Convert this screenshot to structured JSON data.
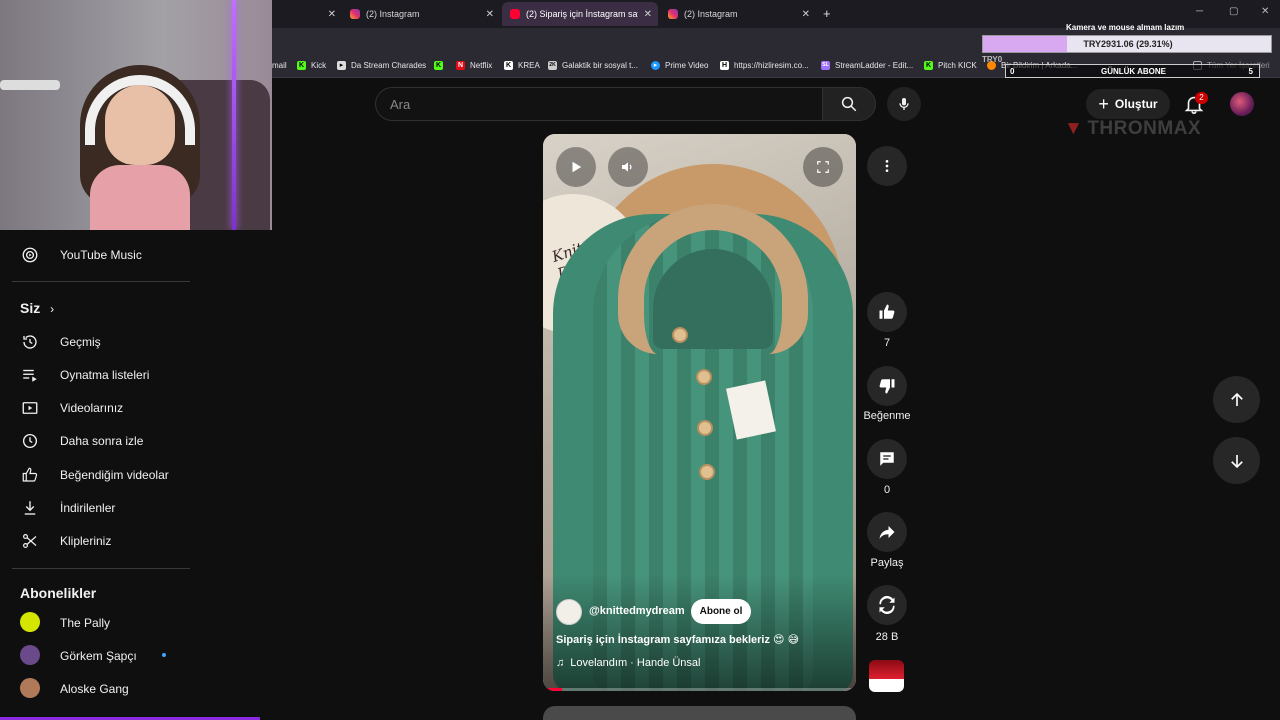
{
  "browser": {
    "tabs": [
      {
        "label": "",
        "favicon": "none"
      },
      {
        "label": "(2) Instagram",
        "favicon": "instagram-icon"
      },
      {
        "label": "(2) Sipariş için İnstagram sayfam",
        "favicon": "youtube-icon",
        "active": true
      },
      {
        "label": "(2) Instagram",
        "favicon": "instagram-icon"
      }
    ],
    "bookmarks": [
      {
        "label": "mail",
        "icon": "gmail-icon",
        "color": "#ea4335"
      },
      {
        "label": "Kick",
        "icon": "kick-icon",
        "color": "#53fc18"
      },
      {
        "label": "Da Stream Charades",
        "icon": "pointer-icon",
        "color": "#ffffff"
      },
      {
        "label": "",
        "icon": "kick-icon",
        "color": "#53fc18"
      },
      {
        "label": "Netflix",
        "icon": "netflix-icon",
        "color": "#e50914"
      },
      {
        "label": "KREA",
        "icon": "krea-icon",
        "color": "#ffffff"
      },
      {
        "label": "Galaktik bir sosyal t...",
        "icon": "zk-icon",
        "color": "#cccccc"
      },
      {
        "label": "Prime Video",
        "icon": "prime-icon",
        "color": "#1a98ff"
      },
      {
        "label": "https://hizliresim.co...",
        "icon": "h-icon",
        "color": "#ffffff"
      },
      {
        "label": "StreamLadder - Edit...",
        "icon": "sl-icon",
        "color": "#a070ff"
      },
      {
        "label": "Pitch KICK",
        "icon": "kick-icon",
        "color": "#53fc18"
      },
      {
        "label": "Bir Bildirim | Arkada...",
        "icon": "bell-icon",
        "color": "#ff8800"
      },
      {
        "label": "Tüm Yer İşaretleri",
        "icon": "folder-icon",
        "color": "#cccccc"
      }
    ]
  },
  "header": {
    "search_placeholder": "Ara",
    "create_label": "Oluştur",
    "notification_count": "2"
  },
  "sidebar": {
    "top_item": "YouTube Music",
    "you_heading": "Siz",
    "you_items": [
      {
        "label": "Geçmiş",
        "icon": "history-icon"
      },
      {
        "label": "Oynatma listeleri",
        "icon": "playlists-icon"
      },
      {
        "label": "Videolarınız",
        "icon": "your-videos-icon"
      },
      {
        "label": "Daha sonra izle",
        "icon": "watch-later-icon"
      },
      {
        "label": "Beğendiğim videolar",
        "icon": "liked-videos-icon"
      },
      {
        "label": "İndirilenler",
        "icon": "downloads-icon"
      },
      {
        "label": "Klipleriniz",
        "icon": "clips-icon"
      }
    ],
    "subs_heading": "Abonelikler",
    "subscriptions": [
      {
        "label": "The Pally",
        "color": "#d4e600",
        "live": false
      },
      {
        "label": "Görkem Şapçı",
        "color": "#6a4a8a",
        "live": true
      },
      {
        "label": "Aloske Gang",
        "color": "#b07a5a",
        "live": false
      }
    ]
  },
  "short": {
    "sign_text": "Knitted Dream",
    "channel": "@knittedmydream",
    "subscribe_label": "Abone ol",
    "title": "Sipariş için İnstagram sayfamıza bekleriz 😍 😅",
    "music": "Lovelandım · Hande Ünsal",
    "progress": 0.06
  },
  "actions": {
    "likes": "7",
    "dislike_label": "Beğenme",
    "comments": "0",
    "share_label": "Paylaş",
    "remix_count": "28 B"
  },
  "overlay": {
    "note": "Kamera ve mouse almam lazım",
    "donation_text": "TRY2931.06 (29.31%)",
    "donation_fraction": 0.2931,
    "try_label": "TRY0",
    "subs_title": "GÜNLÜK ABONE",
    "subs_min": "0",
    "subs_max": "5",
    "logo": "THRONMAX"
  }
}
